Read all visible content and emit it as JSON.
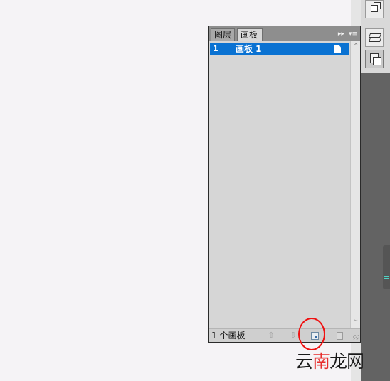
{
  "panel": {
    "tabs": [
      {
        "label": "图层"
      },
      {
        "label": "画板"
      }
    ],
    "tools": {
      "collapse": "▸▸",
      "menu": "▾≡"
    },
    "rows": [
      {
        "number": "1",
        "name": "画板 1"
      }
    ],
    "footer": {
      "count_label": "1 个画板"
    }
  },
  "watermark": {
    "part1": "云",
    "part2": "南",
    "part3": "龙网"
  },
  "colors": {
    "selection": "#0a72d2",
    "annotation": "#ef1111",
    "dock": "#636363"
  }
}
